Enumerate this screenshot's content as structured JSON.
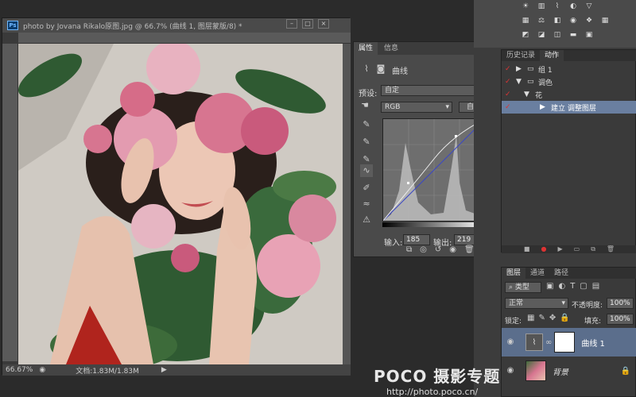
{
  "document": {
    "ps_badge": "Ps",
    "title": "photo by Jovana Rikalo原图.jpg @ 66.7% (曲线 1, 图层蒙版/8) *",
    "zoom": "66.67%",
    "status": "文档:1.83M/1.83M"
  },
  "properties": {
    "tabs": [
      "属性",
      "信息"
    ],
    "adj_title": "曲线",
    "preset_label": "预设:",
    "preset_value": "自定",
    "channel_value": "RGB",
    "auto_button": "自动",
    "input_label": "输入:",
    "input_value": "185",
    "output_label": "输出:",
    "output_value": "219"
  },
  "history": {
    "tabs": [
      "历史记录",
      "动作"
    ],
    "rows": [
      "组 1",
      "调色",
      "花",
      "建立 调整图层"
    ]
  },
  "layers": {
    "tabs": [
      "图层",
      "通道",
      "路径"
    ],
    "kind_label": "类型",
    "blend_mode": "正常",
    "opacity_label": "不透明度:",
    "opacity_value": "100%",
    "lock_label": "锁定:",
    "fill_label": "填充:",
    "fill_value": "100%",
    "items": [
      {
        "name": "曲线 1",
        "selected": true
      },
      {
        "name": "背景",
        "selected": false
      }
    ]
  },
  "watermark": {
    "logo": "POCO 摄影专题",
    "url": "http://photo.poco.cn/"
  },
  "colors": {
    "accent_selected": "#6a7fa0",
    "curve_blue": "#3b47c4"
  }
}
